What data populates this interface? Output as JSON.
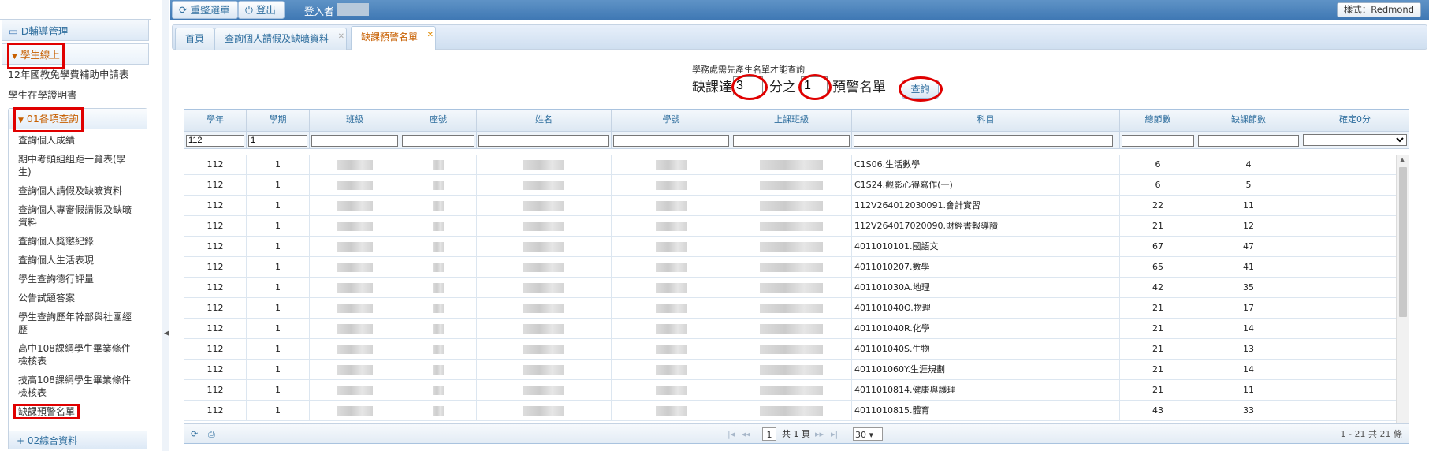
{
  "sidebar": {
    "section_counsel": "D輔導管理",
    "section_student_online": "學生線上",
    "item_subsidy": "12年國教免學費補助申請表",
    "item_enrollment": "學生在學證明書",
    "submenu_title": "01各項查詢",
    "submenu_items": [
      "查詢個人成績",
      "期中考頭組組距一覽表(學生)",
      "查詢個人請假及缺曠資料",
      "查詢個人專審假請假及缺曠資料",
      "查詢個人獎懲紀錄",
      "查詢個人生活表現",
      "學生查詢德行評量",
      "公告試題答案",
      "學生查詢歷年幹部與社團經歷",
      "高中108課綱學生畢業條件檢核表",
      "技高108課綱學生畢業條件檢核表",
      "缺課預警名單"
    ],
    "section_integrated": "02綜合資料"
  },
  "topbar": {
    "reset_menu": "重整選單",
    "logout": "登出",
    "login_label": "登入者",
    "style_label": "樣式：Redmond"
  },
  "tabs": [
    {
      "label": "首頁",
      "closable": false
    },
    {
      "label": "查詢個人請假及缺曠資料",
      "closable": true
    },
    {
      "label": "缺課預警名單",
      "closable": true
    }
  ],
  "query": {
    "note": "學務處需先產生名單才能查詢",
    "prefix": "缺課達",
    "numerator": "3",
    "middle": "分之",
    "denominator": "1",
    "suffix": "預警名單",
    "button": "查詢"
  },
  "grid": {
    "columns": [
      "學年",
      "學期",
      "班級",
      "座號",
      "姓名",
      "學號",
      "上課班級",
      "科目",
      "總節數",
      "缺課節數",
      "確定0分"
    ],
    "filters": {
      "year": "112",
      "semester": "1"
    },
    "rows": [
      {
        "year": "112",
        "sem": "1",
        "subject": "C1S06.生活數學",
        "total": "6",
        "absent": "4"
      },
      {
        "year": "112",
        "sem": "1",
        "subject": "C1S24.觀影心得寫作(一)",
        "total": "6",
        "absent": "5"
      },
      {
        "year": "112",
        "sem": "1",
        "subject": "112V264012030091.會計實習",
        "total": "22",
        "absent": "11"
      },
      {
        "year": "112",
        "sem": "1",
        "subject": "112V264017020090.財經書報導讀",
        "total": "21",
        "absent": "12"
      },
      {
        "year": "112",
        "sem": "1",
        "subject": "4011010101.國語文",
        "total": "67",
        "absent": "47"
      },
      {
        "year": "112",
        "sem": "1",
        "subject": "4011010207.數學",
        "total": "65",
        "absent": "41"
      },
      {
        "year": "112",
        "sem": "1",
        "subject": "401101030A.地理",
        "total": "42",
        "absent": "35"
      },
      {
        "year": "112",
        "sem": "1",
        "subject": "401101040O.物理",
        "total": "21",
        "absent": "17"
      },
      {
        "year": "112",
        "sem": "1",
        "subject": "401101040R.化學",
        "total": "21",
        "absent": "14"
      },
      {
        "year": "112",
        "sem": "1",
        "subject": "401101040S.生物",
        "total": "21",
        "absent": "13"
      },
      {
        "year": "112",
        "sem": "1",
        "subject": "401101060Y.生涯規劃",
        "total": "21",
        "absent": "14"
      },
      {
        "year": "112",
        "sem": "1",
        "subject": "4011010814.健康與護理",
        "total": "21",
        "absent": "11"
      },
      {
        "year": "112",
        "sem": "1",
        "subject": "4011010815.體育",
        "total": "43",
        "absent": "33"
      }
    ],
    "pager": {
      "page": "1",
      "total_pages": "共 1 頁",
      "page_size": "30",
      "summary": "1 - 21 共 21 條"
    }
  }
}
